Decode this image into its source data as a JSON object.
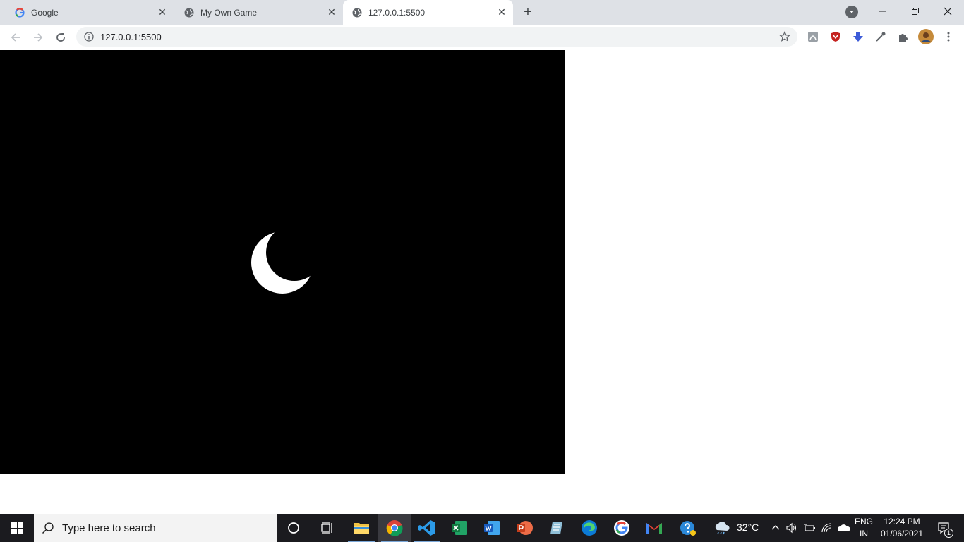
{
  "browser": {
    "tabs": [
      {
        "title": "Google",
        "favicon": "google-g-icon"
      },
      {
        "title": "My Own Game",
        "favicon": "globe-icon"
      },
      {
        "title": "127.0.0.1:5500",
        "favicon": "globe-icon",
        "active": true
      }
    ],
    "address": "127.0.0.1:5500"
  },
  "page": {
    "canvas_color": "#000000",
    "moon_color": "#ffffff"
  },
  "taskbar": {
    "search_placeholder": "Type here to search",
    "weather": "32°C",
    "language": "ENG",
    "region": "IN",
    "time": "12:24 PM",
    "date": "01/06/2021",
    "notification_count": "1"
  },
  "colors": {
    "tabstrip": "#dee1e6",
    "taskbar": "#1b1b1f",
    "accent": "#1a73e8"
  }
}
